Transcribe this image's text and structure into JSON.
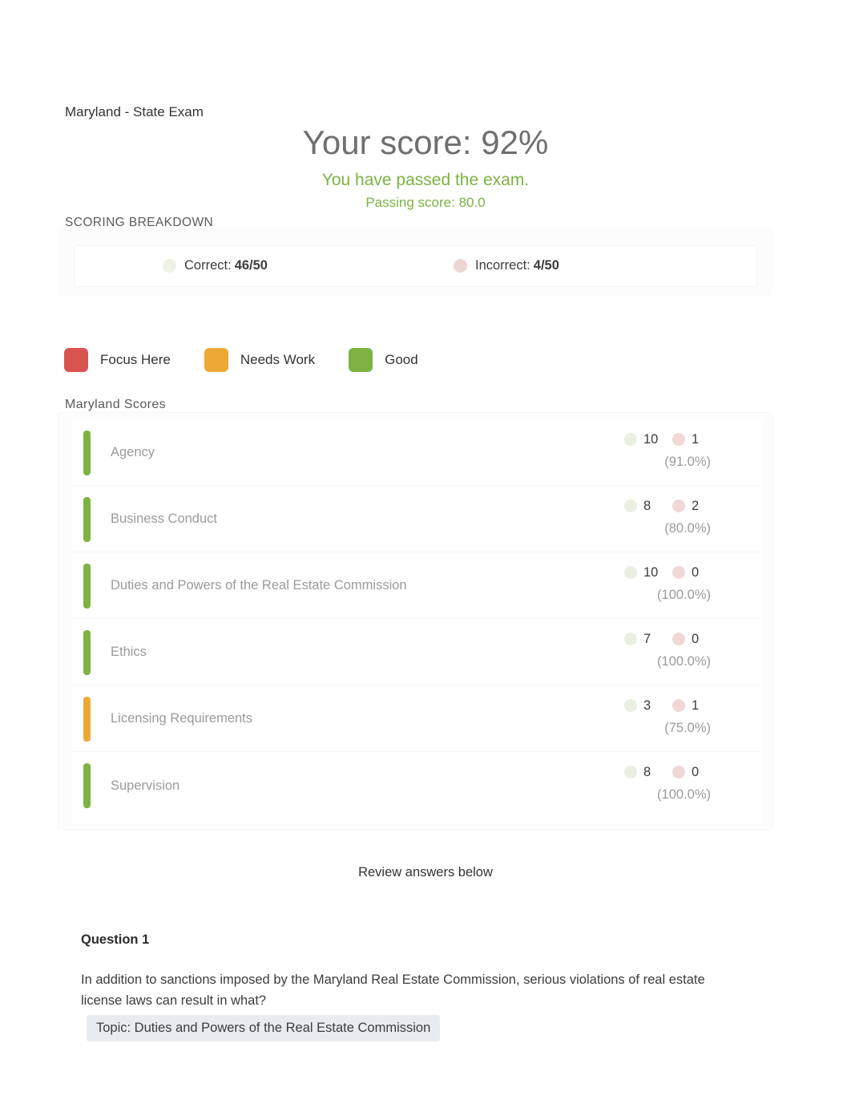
{
  "exam": {
    "title": "Maryland - State Exam"
  },
  "result": {
    "score_headline": "Your score: 92%",
    "pass_message": "You have passed the exam.",
    "passing_score": "Passing score: 80.0"
  },
  "breakdown": {
    "label": "SCORING BREAKDOWN",
    "correct_label": "Correct:",
    "correct_value": "46/50",
    "incorrect_label": "Incorrect:",
    "incorrect_value": "4/50"
  },
  "legend": {
    "items": [
      {
        "label": "Focus Here",
        "color": "#d9534f"
      },
      {
        "label": "Needs Work",
        "color": "#eda935"
      },
      {
        "label": "Good",
        "color": "#7cb342"
      }
    ]
  },
  "scores": {
    "label": "Maryland Scores",
    "rows": [
      {
        "topic": "Agency",
        "correct": "10",
        "incorrect": "1",
        "percent": "(91.0%)",
        "bar_color": "#7cb342"
      },
      {
        "topic": "Business Conduct",
        "correct": "8",
        "incorrect": "2",
        "percent": "(80.0%)",
        "bar_color": "#7cb342"
      },
      {
        "topic": "Duties and Powers of the Real Estate Commission",
        "correct": "10",
        "incorrect": "0",
        "percent": "(100.0%)",
        "bar_color": "#7cb342"
      },
      {
        "topic": "Ethics",
        "correct": "7",
        "incorrect": "0",
        "percent": "(100.0%)",
        "bar_color": "#7cb342"
      },
      {
        "topic": "Licensing Requirements",
        "correct": "3",
        "incorrect": "1",
        "percent": "(75.0%)",
        "bar_color": "#eda935"
      },
      {
        "topic": "Supervision",
        "correct": "8",
        "incorrect": "0",
        "percent": "(100.0%)",
        "bar_color": "#7cb342"
      }
    ]
  },
  "review": {
    "heading": "Review answers below",
    "question_number": "Question 1",
    "question_text": "In addition to sanctions imposed by the Maryland Real Estate Commission, serious violations of real estate license laws can result in what?",
    "topic_badge": "Topic: Duties and Powers of the Real Estate Commission"
  }
}
